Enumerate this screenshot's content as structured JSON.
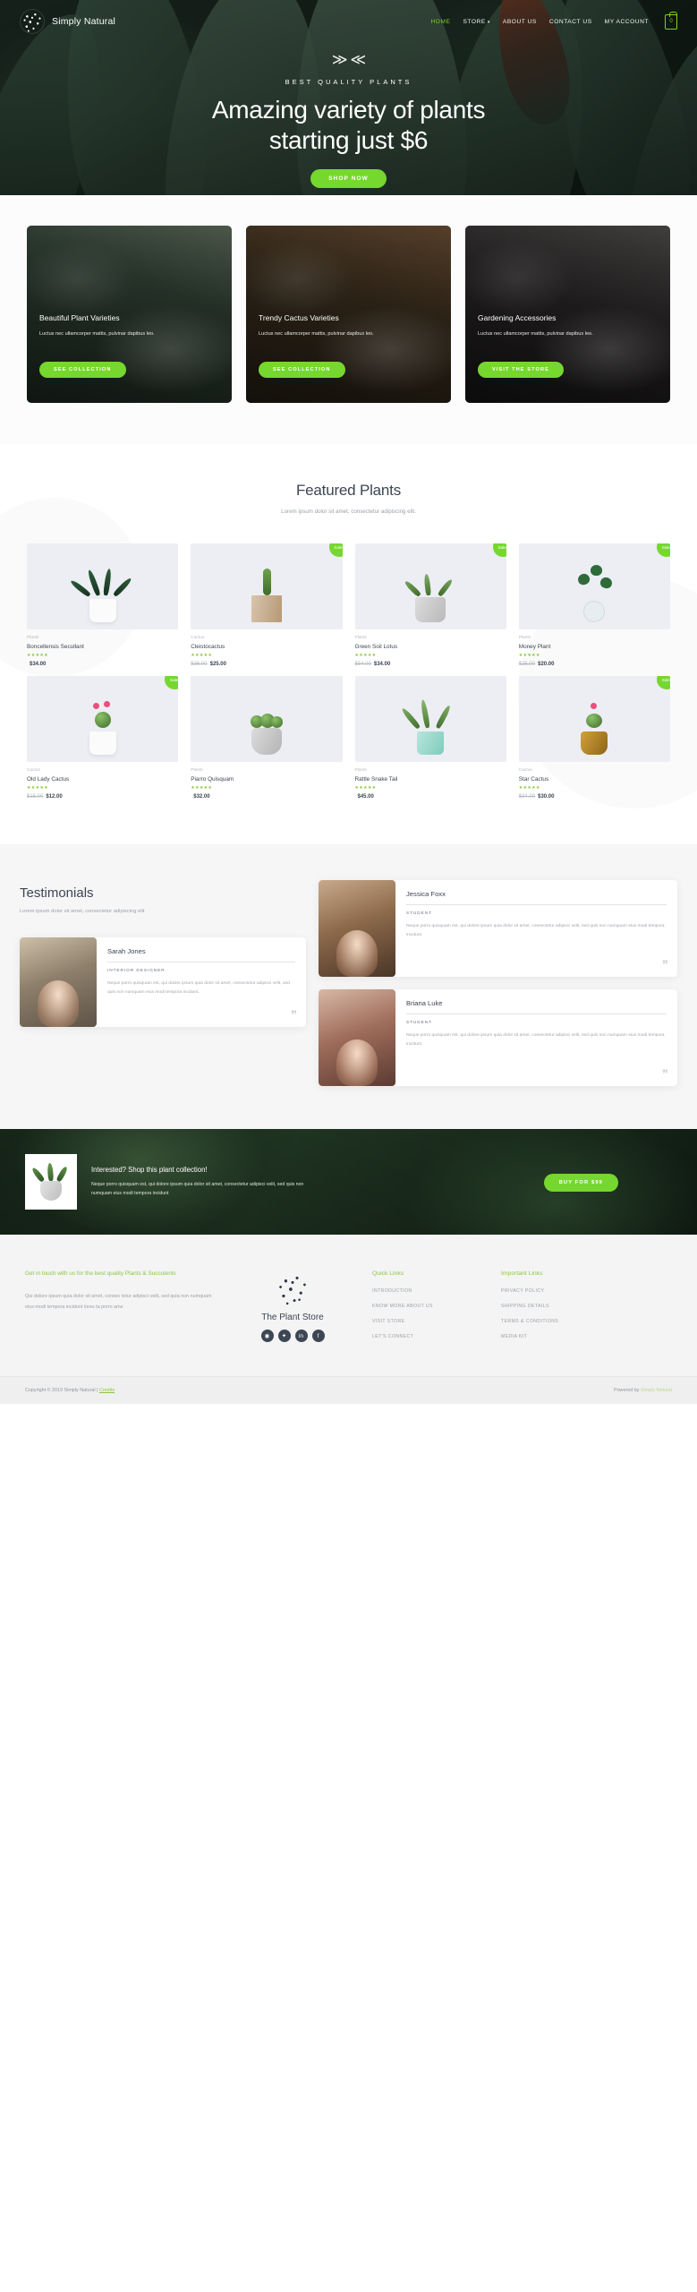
{
  "header": {
    "brand": "Simply Natural",
    "nav": [
      {
        "label": "HOME",
        "active": true
      },
      {
        "label": "STORE",
        "caret": true
      },
      {
        "label": "ABOUT US"
      },
      {
        "label": "CONTACT US"
      },
      {
        "label": "MY ACCOUNT"
      }
    ],
    "cart_count": "0"
  },
  "hero": {
    "kicker": "BEST QUALITY PLANTS",
    "title_line1": "Amazing variety of plants",
    "title_line2": "starting just $6",
    "cta": "SHOP NOW"
  },
  "collections": [
    {
      "title": "Beautiful Plant Varieties",
      "desc": "Luctus nec ullamcorper mattis, pulvinar dapibus leo.",
      "button": "SEE COLLECTION"
    },
    {
      "title": "Trendy Cactus Varieties",
      "desc": "Luctus nec ullamcorper mattis, pulvinar dapibus leo.",
      "button": "SEE COLLECTION"
    },
    {
      "title": "Gardening Accessories",
      "desc": "Luctus nec ullamcorper mattis, pulvinar dapibus leo.",
      "button": "VISIT THE STORE"
    }
  ],
  "featured": {
    "title": "Featured Plants",
    "subtitle": "Lorem ipsum dolor sit amet, consectetur adipiscing elit.",
    "sale_badge": "Sale!",
    "stars": "★★★★★",
    "products": [
      {
        "category": "Plants",
        "name": "Boncellensis Secullant",
        "old_price": "",
        "price": "$34.00",
        "sale": false
      },
      {
        "category": "Cactus",
        "name": "Cleistocactus",
        "old_price": "$36.00",
        "price": "$25.00",
        "sale": true
      },
      {
        "category": "Plants",
        "name": "Green Soil Lotus",
        "old_price": "$54.00",
        "price": "$34.00",
        "sale": true
      },
      {
        "category": "Plants",
        "name": "Money Plant",
        "old_price": "$25.00",
        "price": "$20.00",
        "sale": true
      },
      {
        "category": "Cactus",
        "name": "Old Lady Cactus",
        "old_price": "$15.00",
        "price": "$12.00",
        "sale": true
      },
      {
        "category": "Plants",
        "name": "Piarro Quisquam",
        "old_price": "",
        "price": "$32.00",
        "sale": false
      },
      {
        "category": "Plants",
        "name": "Rattle Snake Tail",
        "old_price": "",
        "price": "$45.00",
        "sale": false
      },
      {
        "category": "Cactus",
        "name": "Star Cactus",
        "old_price": "$34.00",
        "price": "$30.00",
        "sale": true
      }
    ]
  },
  "testimonials": {
    "title": "Testimonials",
    "subtitle": "Lorem ipsum dolor sit amet, consectetur adipiscing elit",
    "quote_glyph": "❞",
    "items": [
      {
        "name": "Sarah Jones",
        "role": "INTERIOR DESIGNER",
        "text": "Neque porro quisquam est, qui dolore ipsum quia dolor sit amet, consectetur adipisci velit, sed quis non numquam eius modi tempora incidunt."
      },
      {
        "name": "Jessica Foxx",
        "role": "STUDENT",
        "text": "Neque porro quisquam est, qui dolore ipsum quia dolor sit amet, consectetur adipisci velit, sed quis non numquam eius modi tempora incidunt."
      },
      {
        "name": "Briana Luke",
        "role": "STUDENT",
        "text": "Neque porro quisquam est, qui dolore ipsum quia dolor sit amet, consectetur adipisci velit, sed quis non numquam eius modi tempora incidunt."
      }
    ]
  },
  "promo": {
    "title": "Interested? Shop this plant collection!",
    "desc": "Neque porro quisquam est, qui dolore ipsum quia dolor sit amet, consectetur adipisci velit, sed quis non numquam eius modi tempora incidunt",
    "button": "BUY FOR $99"
  },
  "footer": {
    "lead": "Get in touch with us for the best quality Plants & Succulents",
    "body": "Qui dolore ipsum quia dolor sit amet, consec tetur adipisci velit, sed quia non numquam eius modi tempora incidunt lores ta porro ame",
    "store_name": "The Plant Store",
    "socials": [
      {
        "name": "instagram-icon",
        "glyph": "◉"
      },
      {
        "name": "twitter-icon",
        "glyph": "🐦"
      },
      {
        "name": "linkedin-icon",
        "glyph": "in"
      },
      {
        "name": "facebook-icon",
        "glyph": "f"
      }
    ],
    "quick_links_title": "Quick Links",
    "quick_links": [
      "INTRODUCTION",
      "KNOW MORE ABOUT US",
      "VISIT STORE",
      "LET'S CONNECT"
    ],
    "important_links_title": "Important Links",
    "important_links": [
      "PRIVACY POLICY",
      "SHIPPING DETAILS",
      "TERMS & CONDITIONS",
      "MEDIA KIT"
    ],
    "copyright": "Copyright © 2019 Simply Natural | ",
    "credits": "Credits",
    "powered_prefix": "Powered by ",
    "powered_brand": "Simply Natural"
  },
  "colors": {
    "accent_green": "#76d72f",
    "link_green": "#8cc63e",
    "dark_text": "#3c4553",
    "muted": "#9aa0a8"
  }
}
